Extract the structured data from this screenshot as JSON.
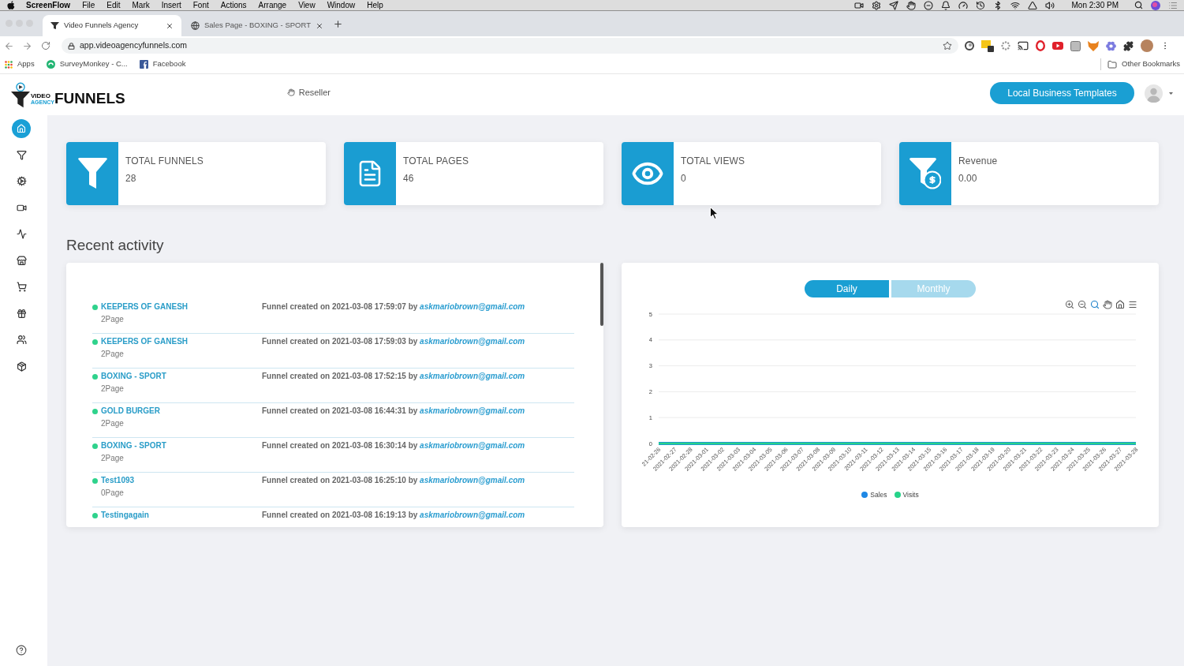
{
  "menu_bar": {
    "app": "ScreenFlow",
    "menus": [
      "File",
      "Edit",
      "Mark",
      "Insert",
      "Font",
      "Actions",
      "Arrange",
      "View",
      "Window",
      "Help"
    ],
    "clock": "Mon 2:30 PM"
  },
  "browser": {
    "tabs": [
      {
        "title": "Video Funnels Agency",
        "selected": true
      },
      {
        "title": "Sales Page - BOXING - SPORT",
        "selected": false
      }
    ],
    "url": "app.videoagencyfunnels.com",
    "bookmarks": [
      "Apps",
      "SurveyMonkey - C...",
      "Facebook"
    ],
    "other_bookmarks": "Other Bookmarks"
  },
  "header": {
    "logo": {
      "top": "VIDEO",
      "sub": "AGENCY",
      "main": "FUNNELS"
    },
    "reseller": "Reseller",
    "templates_button": "Local Business Templates"
  },
  "sidebar": {
    "items": [
      {
        "selected": true
      },
      {
        "selected": false
      },
      {
        "selected": false
      },
      {
        "selected": false
      },
      {
        "selected": false
      },
      {
        "selected": false
      },
      {
        "selected": false
      },
      {
        "selected": false
      },
      {
        "selected": false
      },
      {
        "selected": false
      }
    ]
  },
  "stats": [
    {
      "title": "TOTAL FUNNELS",
      "value": "28"
    },
    {
      "title": "TOTAL PAGES",
      "value": "46"
    },
    {
      "title": "TOTAL VIEWS",
      "value": "0"
    },
    {
      "title": "Revenue",
      "value": "0.00"
    }
  ],
  "recent_activity": {
    "title": "Recent activity",
    "rows": [
      {
        "name": "KEEPERS OF GANESH",
        "pages": "2Page",
        "description": "Funnel created on 2021-03-08 17:59:07 by",
        "email": "askmariobrown@gmail.com"
      },
      {
        "name": "KEEPERS OF GANESH",
        "pages": "2Page",
        "description": "Funnel created on 2021-03-08 17:59:03 by",
        "email": "askmariobrown@gmail.com"
      },
      {
        "name": "BOXING - SPORT",
        "pages": "2Page",
        "description": "Funnel created on 2021-03-08 17:52:15 by",
        "email": "askmariobrown@gmail.com"
      },
      {
        "name": "GOLD BURGER",
        "pages": "2Page",
        "description": "Funnel created on 2021-03-08 16:44:31 by",
        "email": "askmariobrown@gmail.com"
      },
      {
        "name": "BOXING - SPORT",
        "pages": "2Page",
        "description": "Funnel created on 2021-03-08 16:30:14 by",
        "email": "askmariobrown@gmail.com"
      },
      {
        "name": "Test1093",
        "pages": "0Page",
        "description": "Funnel created on 2021-03-08 16:25:10 by",
        "email": "askmariobrown@gmail.com"
      },
      {
        "name": "Testingagain",
        "description": "Funnel created on 2021-03-08 16:19:13 by",
        "email": "askmariobrown@gmail.com"
      }
    ]
  },
  "chart": {
    "toggles": [
      {
        "label": "Daily",
        "selected": true
      },
      {
        "label": "Monthly",
        "selected": false
      }
    ],
    "chart_data": {
      "type": "line",
      "categories": [
        "21-02-26",
        "2021-02-27",
        "2021-02-28",
        "2021-03-01",
        "2021-03-02",
        "2021-03-03",
        "2021-03-04",
        "2021-03-05",
        "2021-03-06",
        "2021-03-07",
        "2021-03-08",
        "2021-03-09",
        "2021-03-10",
        "2021-03-11",
        "2021-03-12",
        "2021-03-13",
        "2021-03-14",
        "2021-03-15",
        "2021-03-16",
        "2021-03-17",
        "2021-03-18",
        "2021-03-19",
        "2021-03-20",
        "2021-03-21",
        "2021-03-22",
        "2021-03-23",
        "2021-03-24",
        "2021-03-25",
        "2021-03-26",
        "2021-03-27",
        "2021-03-28"
      ],
      "series": [
        {
          "name": "Sales",
          "color": "#1e88e5",
          "values": [
            0,
            0,
            0,
            0,
            0,
            0,
            0,
            0,
            0,
            0,
            0,
            0,
            0,
            0,
            0,
            0,
            0,
            0,
            0,
            0,
            0,
            0,
            0,
            0,
            0,
            0,
            0,
            0,
            0,
            0,
            0
          ]
        },
        {
          "name": "Visits",
          "color": "#27d38a",
          "values": [
            0,
            0,
            0,
            0,
            0,
            0,
            0,
            0,
            0,
            0,
            0,
            0,
            0,
            0,
            0,
            0,
            0,
            0,
            0,
            0,
            0,
            0,
            0,
            0,
            0,
            0,
            0,
            0,
            0,
            0,
            0
          ]
        }
      ],
      "ylim": [
        0,
        5
      ],
      "yticks": [
        0,
        1,
        2,
        3,
        4,
        5
      ],
      "grid": true
    }
  }
}
